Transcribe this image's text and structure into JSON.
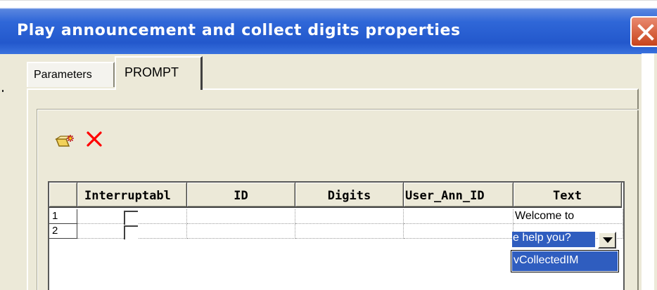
{
  "window": {
    "title": "Play announcement and collect digits properties",
    "close_icon": "close-icon"
  },
  "tabs": [
    {
      "label": "Parameters",
      "active": false
    },
    {
      "label": "PROMPT",
      "active": true
    }
  ],
  "toolbar": {
    "new_icon": "new-row-icon",
    "delete_icon": "delete-icon",
    "delete_color": "#ff0000"
  },
  "grid": {
    "columns": [
      "Interruptabl",
      "ID",
      "Digits",
      "User_Ann_ID",
      "Text"
    ],
    "rows": [
      {
        "number": "1",
        "interruptable": false,
        "id": "",
        "digits": "",
        "user_ann_id": "",
        "text": "Welcome to"
      },
      {
        "number": "2",
        "interruptable": false,
        "id": "",
        "digits": "",
        "user_ann_id": "",
        "text": "e help you?"
      }
    ],
    "dropdown_option": "vCollectedIM",
    "selection_color": "#2f5dbf"
  }
}
